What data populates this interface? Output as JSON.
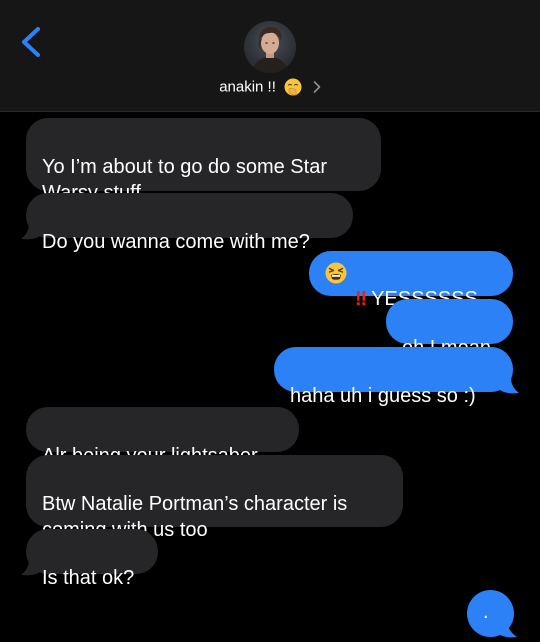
{
  "header": {
    "contact_name": "anakin !!",
    "contact_emoji_icon": "face-with-hand-over-mouth-icon",
    "back_icon": "chevron-left-icon",
    "details_icon": "chevron-right-icon"
  },
  "messages": [
    {
      "direction": "incoming",
      "text": "Yo I’m about to go do some Star\nWarsy stuff"
    },
    {
      "direction": "incoming",
      "text": "Do you wanna come with me?"
    },
    {
      "direction": "outgoing",
      "emoji_icon": "tired-face-icon",
      "punct": "‼",
      "text": "YESSSSSS"
    },
    {
      "direction": "outgoing",
      "text": "oh I mean"
    },
    {
      "direction": "outgoing",
      "text": "haha uh i guess so :)"
    },
    {
      "direction": "incoming",
      "text": "Alr being your lightsaber"
    },
    {
      "direction": "incoming",
      "text": "Btw Natalie Portman’s character is\ncoming with us too"
    },
    {
      "direction": "incoming",
      "text": "Is that ok?"
    },
    {
      "direction": "outgoing",
      "text": "."
    }
  ],
  "colors": {
    "incoming_bubble": "#262628",
    "outgoing_bubble": "#2d81f7",
    "accent": "#2d81f7",
    "background": "#000000",
    "header_background": "#161616"
  }
}
